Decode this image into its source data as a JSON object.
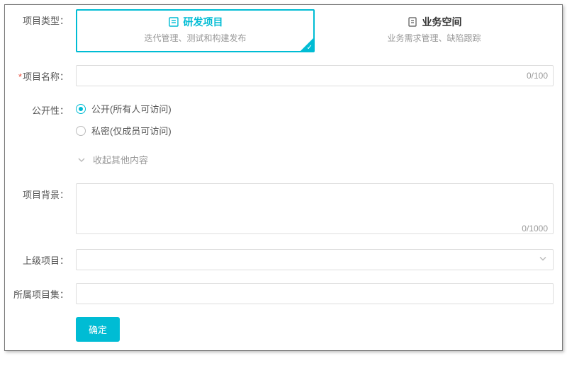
{
  "labels": {
    "project_type": "项目类型：",
    "project_name": "项目名称：",
    "visibility": "公开性：",
    "collapse": "收起其他内容",
    "project_bg": "项目背景：",
    "parent_project": "上级项目：",
    "project_set": "所属项目集："
  },
  "type_cards": [
    {
      "title": "研发项目",
      "desc": "迭代管理、测试和构建发布",
      "selected": true
    },
    {
      "title": "业务空间",
      "desc": "业务需求管理、缺陷跟踪",
      "selected": false
    }
  ],
  "project_name": {
    "value": "",
    "counter": "0/100"
  },
  "visibility_options": [
    {
      "label": "公开(所有人可访问)",
      "checked": true
    },
    {
      "label": "私密(仅成员可访问)",
      "checked": false
    }
  ],
  "project_bg": {
    "value": "",
    "counter": "0/1000"
  },
  "buttons": {
    "submit": "确定"
  }
}
